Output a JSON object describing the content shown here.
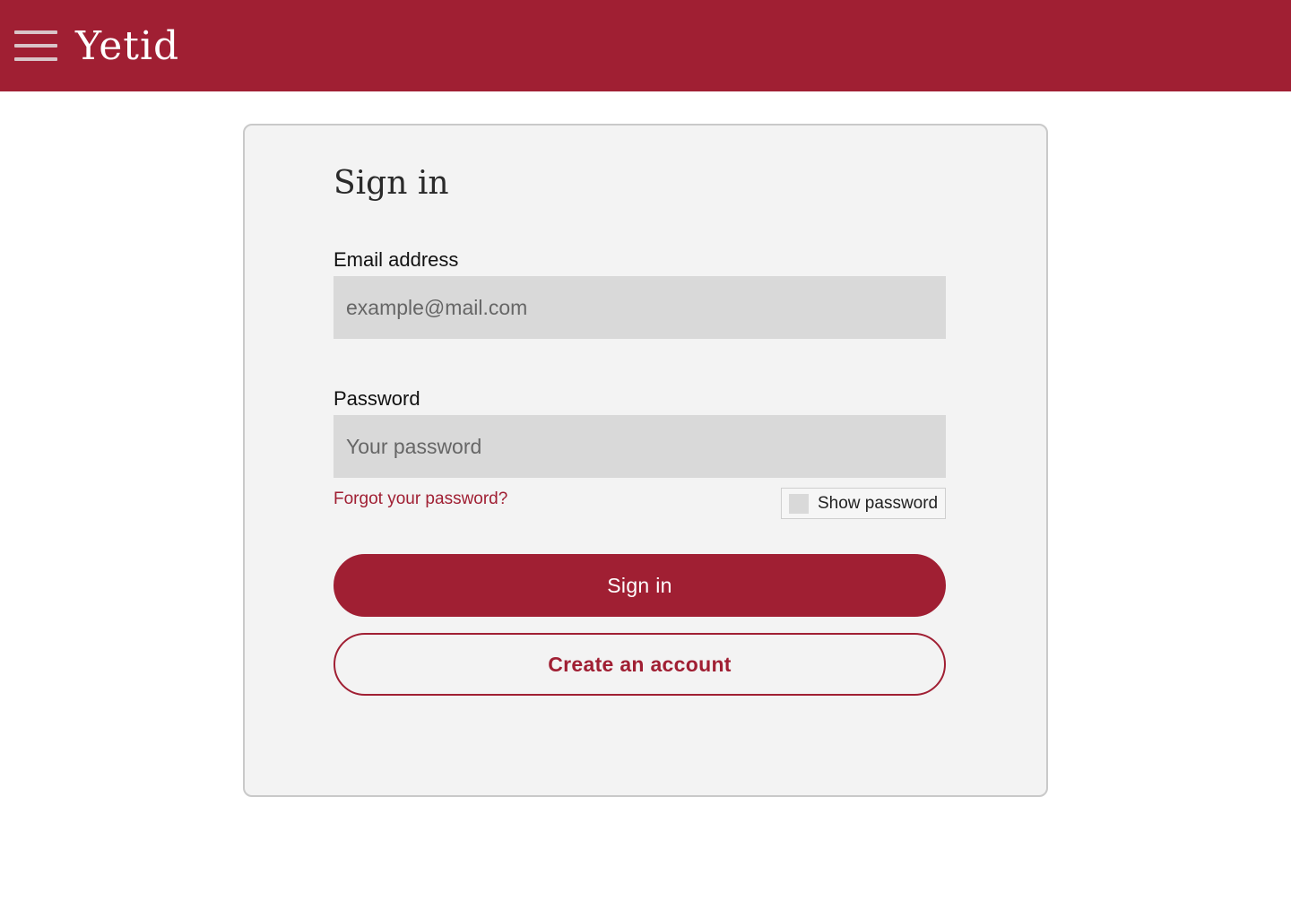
{
  "header": {
    "brand": "Yetid",
    "background_color": "#a01f33",
    "menu_icon": "hamburger-menu-icon"
  },
  "signin": {
    "title": "Sign in",
    "email": {
      "label": "Email address",
      "placeholder": "example@mail.com",
      "value": ""
    },
    "password": {
      "label": "Password",
      "placeholder": "Your password",
      "value": ""
    },
    "forgot_link": "Forgot your password?",
    "show_password": {
      "label": "Show password",
      "checked": false
    },
    "primary_button": "Sign in",
    "secondary_button": "Create an account",
    "accent_color": "#a01f33"
  }
}
